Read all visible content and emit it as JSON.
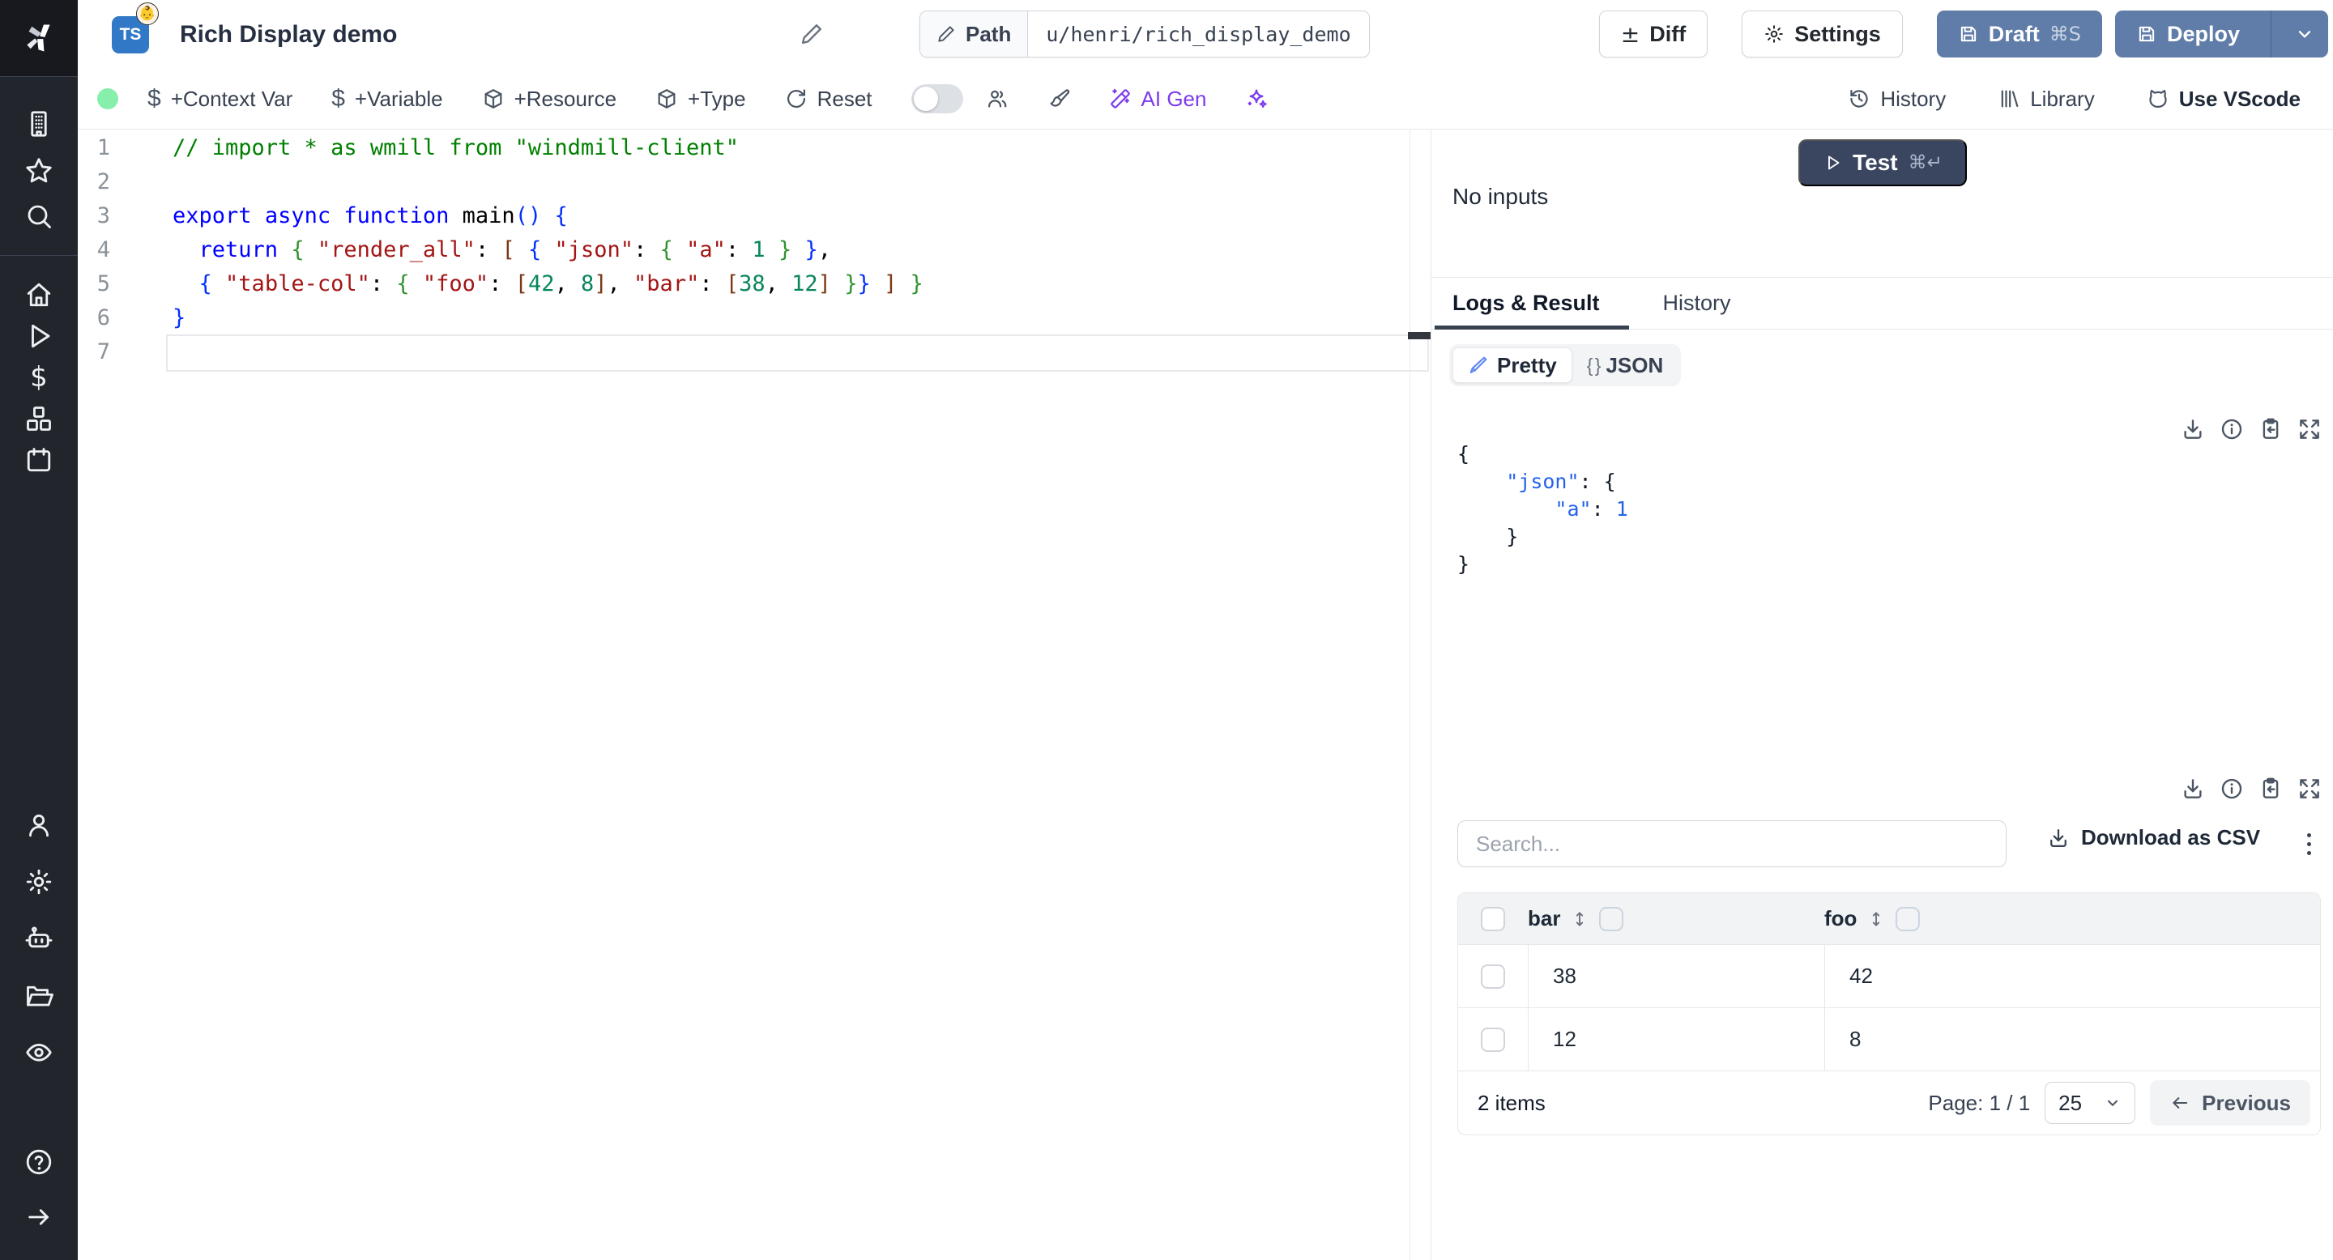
{
  "window": {
    "title": "Rich Display demo",
    "language_badge": "TS",
    "script_emoji": "👶",
    "path_label": "Path",
    "path_value": "u/henri/rich_display_demo"
  },
  "header_buttons": {
    "diff": "Diff",
    "settings": "Settings",
    "draft": "Draft",
    "draft_shortcut": "⌘S",
    "deploy": "Deploy"
  },
  "toolbar": {
    "status_dot_color": "#86efac",
    "context_var": "+Context Var",
    "variable": "+Variable",
    "resource": "+Resource",
    "type": "+Type",
    "reset": "Reset",
    "ai_gen": "AI Gen",
    "history": "History",
    "library": "Library",
    "vscode": "Use VScode"
  },
  "sidebar": {
    "icons": [
      "windmill-logo",
      "building",
      "star",
      "search",
      "home",
      "play",
      "dollar",
      "boxes",
      "calendar",
      "user",
      "settings-gear",
      "bot",
      "folder-open",
      "eye",
      "help-circle",
      "arrow-right"
    ]
  },
  "editor": {
    "language": "typescript",
    "lines": [
      {
        "n": "1",
        "tokens": [
          {
            "t": "// import * as wmill from \"windmill-client\"",
            "c": "cm"
          }
        ]
      },
      {
        "n": "2",
        "tokens": []
      },
      {
        "n": "3",
        "tokens": [
          {
            "t": "export",
            "c": "kw"
          },
          {
            "t": " ",
            "c": "pl"
          },
          {
            "t": "async",
            "c": "kw"
          },
          {
            "t": " ",
            "c": "pl"
          },
          {
            "t": "function",
            "c": "kw"
          },
          {
            "t": " main",
            "c": "pl"
          },
          {
            "t": "()",
            "c": "b1"
          },
          {
            "t": " ",
            "c": "pl"
          },
          {
            "t": "{",
            "c": "b1"
          }
        ]
      },
      {
        "n": "4",
        "tokens": [
          {
            "t": "  ",
            "c": "pl"
          },
          {
            "t": "return",
            "c": "kw"
          },
          {
            "t": " ",
            "c": "pl"
          },
          {
            "t": "{",
            "c": "b2"
          },
          {
            "t": " ",
            "c": "pl"
          },
          {
            "t": "\"render_all\"",
            "c": "st"
          },
          {
            "t": ": ",
            "c": "pl"
          },
          {
            "t": "[",
            "c": "b3"
          },
          {
            "t": " ",
            "c": "pl"
          },
          {
            "t": "{",
            "c": "b1"
          },
          {
            "t": " ",
            "c": "pl"
          },
          {
            "t": "\"json\"",
            "c": "st"
          },
          {
            "t": ": ",
            "c": "pl"
          },
          {
            "t": "{",
            "c": "b2"
          },
          {
            "t": " ",
            "c": "pl"
          },
          {
            "t": "\"a\"",
            "c": "st"
          },
          {
            "t": ": ",
            "c": "pl"
          },
          {
            "t": "1",
            "c": "nu"
          },
          {
            "t": " ",
            "c": "pl"
          },
          {
            "t": "}",
            "c": "b2"
          },
          {
            "t": " ",
            "c": "pl"
          },
          {
            "t": "}",
            "c": "b1"
          },
          {
            "t": ",",
            "c": "pl"
          }
        ]
      },
      {
        "n": "5",
        "tokens": [
          {
            "t": "  ",
            "c": "pl"
          },
          {
            "t": "{",
            "c": "b1"
          },
          {
            "t": " ",
            "c": "pl"
          },
          {
            "t": "\"table-col\"",
            "c": "st"
          },
          {
            "t": ": ",
            "c": "pl"
          },
          {
            "t": "{",
            "c": "b2"
          },
          {
            "t": " ",
            "c": "pl"
          },
          {
            "t": "\"foo\"",
            "c": "st"
          },
          {
            "t": ": ",
            "c": "pl"
          },
          {
            "t": "[",
            "c": "b3"
          },
          {
            "t": "42",
            "c": "nu"
          },
          {
            "t": ", ",
            "c": "pl"
          },
          {
            "t": "8",
            "c": "nu"
          },
          {
            "t": "]",
            "c": "b3"
          },
          {
            "t": ", ",
            "c": "pl"
          },
          {
            "t": "\"bar\"",
            "c": "st"
          },
          {
            "t": ": ",
            "c": "pl"
          },
          {
            "t": "[",
            "c": "b3"
          },
          {
            "t": "38",
            "c": "nu"
          },
          {
            "t": ", ",
            "c": "pl"
          },
          {
            "t": "12",
            "c": "nu"
          },
          {
            "t": "]",
            "c": "b3"
          },
          {
            "t": " ",
            "c": "pl"
          },
          {
            "t": "}",
            "c": "b2"
          },
          {
            "t": "}",
            "c": "b1"
          },
          {
            "t": " ",
            "c": "pl"
          },
          {
            "t": "]",
            "c": "b3"
          },
          {
            "t": " ",
            "c": "pl"
          },
          {
            "t": "}",
            "c": "b2"
          }
        ]
      },
      {
        "n": "6",
        "tokens": [
          {
            "t": "}",
            "c": "b1"
          }
        ]
      },
      {
        "n": "7",
        "tokens": []
      }
    ]
  },
  "panel": {
    "test_button": {
      "label": "Test",
      "shortcut": "⌘↵"
    },
    "no_inputs": "No inputs",
    "tabs": {
      "active": "Logs & Result",
      "inactive": "History"
    },
    "view_toggle": {
      "pretty": "Pretty",
      "json": "JSON",
      "braces_glyph": "{ }"
    },
    "result_json": {
      "lines": [
        [
          {
            "t": "{",
            "c": "jb"
          }
        ],
        [
          {
            "t": "    ",
            "c": "jb"
          },
          {
            "t": "\"json\"",
            "c": "jk"
          },
          {
            "t": ": ",
            "c": "jb"
          },
          {
            "t": "{",
            "c": "jb"
          }
        ],
        [
          {
            "t": "        ",
            "c": "jb"
          },
          {
            "t": "\"a\"",
            "c": "jk"
          },
          {
            "t": ": ",
            "c": "jb"
          },
          {
            "t": "1",
            "c": "jn"
          }
        ],
        [
          {
            "t": "    }",
            "c": "jb"
          }
        ],
        [
          {
            "t": "}",
            "c": "jb"
          }
        ]
      ]
    },
    "search_placeholder": "Search...",
    "download_csv": "Download as CSV",
    "table": {
      "columns": [
        "bar",
        "foo"
      ],
      "rows": [
        [
          "38",
          "42"
        ],
        [
          "12",
          "8"
        ]
      ],
      "items_label": "2 items",
      "page_label": "Page: 1 / 1",
      "page_size": "25",
      "previous": "Previous"
    }
  },
  "colors": {
    "sidebar_bg": "#22252b",
    "slate_button": "#5f7da8",
    "test_button": "#3a4660",
    "ai_purple": "#7c3aed",
    "status_green": "#86efac",
    "ts_blue": "#3178c6",
    "tab_underline": "#374151"
  }
}
